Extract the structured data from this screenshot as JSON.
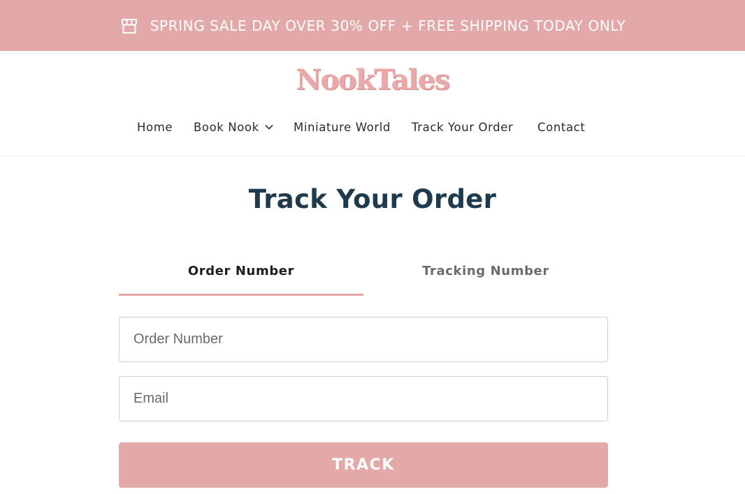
{
  "announcement": {
    "icon": "storefront-icon",
    "text": "SPRING SALE DAY OVER 30% OFF + FREE SHIPPING TODAY ONLY"
  },
  "brand": {
    "logo_text": "NookTales",
    "color": "#eaa8a8"
  },
  "nav": {
    "items": [
      {
        "label": "Home"
      },
      {
        "label": "Book Nook",
        "dropdown_icon": "chevron-down-icon"
      },
      {
        "label": "Miniature World"
      },
      {
        "label": "Track Your Order"
      },
      {
        "label": "Contact"
      }
    ]
  },
  "main": {
    "title": "Track Your Order",
    "tabs": [
      {
        "label": "Order Number",
        "active": true
      },
      {
        "label": "Tracking Number",
        "active": false
      }
    ],
    "fields": {
      "order_number": {
        "placeholder": "Order Number",
        "value": ""
      },
      "email": {
        "placeholder": "Email",
        "value": ""
      }
    },
    "track_button": "TRACK"
  },
  "colors": {
    "accent": "#e3a8a8",
    "title": "#1f3a4d",
    "text": "#2a2a2a"
  }
}
